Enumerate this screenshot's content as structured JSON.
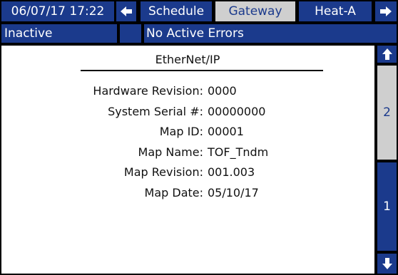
{
  "header": {
    "datetime": "06/07/17 17:22",
    "tabs": [
      {
        "label": "Schedule",
        "active": false
      },
      {
        "label": "Gateway",
        "active": true
      },
      {
        "label": "Heat-A",
        "active": false
      }
    ],
    "left_arrow_icon": "arrow-left-icon",
    "right_arrow_icon": "arrow-right-icon"
  },
  "status": {
    "state": "Inactive",
    "errors": "No Active Errors"
  },
  "main": {
    "title": "EtherNet/IP",
    "fields": [
      {
        "label": "Hardware Revision:",
        "value": "0000"
      },
      {
        "label": "System Serial #:",
        "value": "00000000"
      },
      {
        "label": "Map ID:",
        "value": "00001"
      },
      {
        "label": "Map Name:",
        "value": "TOF_Tndm"
      },
      {
        "label": "Map Revision:",
        "value": "001.003"
      },
      {
        "label": "Map Date:",
        "value": "05/10/17"
      }
    ]
  },
  "pager": {
    "up_icon": "arrow-up-icon",
    "down_icon": "arrow-down-icon",
    "page_2": "2",
    "page_1": "1"
  },
  "colors": {
    "navy": "#1b3a8c",
    "grey": "#cfcfcf",
    "background": "#000000"
  }
}
